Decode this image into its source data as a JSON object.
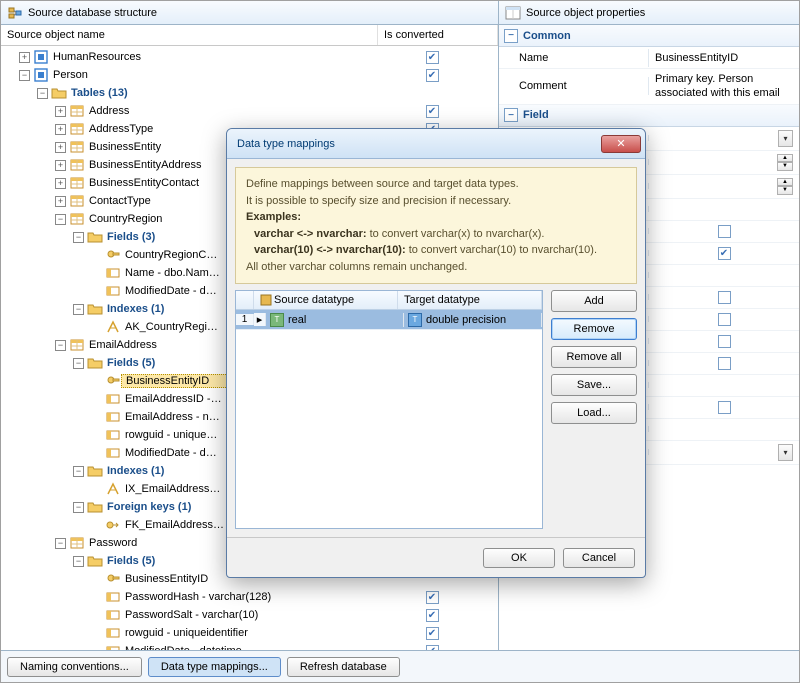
{
  "left_panel": {
    "title": "Source database structure",
    "cols": {
      "name": "Source object name",
      "conv": "Is converted"
    }
  },
  "right_panel": {
    "title": "Source object properties",
    "groups": {
      "common": "Common",
      "field": "Field"
    },
    "props": {
      "name_label": "Name",
      "name_value": "BusinessEntityID",
      "comment_label": "Comment",
      "comment_value": "Primary key. Person associated with this email"
    },
    "field_rows": [
      {
        "kind": "dropdown"
      },
      {
        "kind": "spin"
      },
      {
        "kind": "spin"
      },
      {
        "kind": "blank"
      },
      {
        "kind": "check",
        "checked": false
      },
      {
        "kind": "check",
        "checked": true
      },
      {
        "kind": "blank"
      },
      {
        "kind": "check",
        "checked": false
      },
      {
        "kind": "check",
        "checked": false
      },
      {
        "kind": "check",
        "checked": false
      },
      {
        "kind": "check",
        "checked": false
      },
      {
        "kind": "blank"
      },
      {
        "kind": "check",
        "checked": false
      },
      {
        "kind": "blank"
      },
      {
        "kind": "dropdown"
      }
    ]
  },
  "tree": [
    {
      "d": 1,
      "exp": "plus",
      "icon": "schema",
      "label": "HumanResources",
      "chk": true
    },
    {
      "d": 1,
      "exp": "minus",
      "icon": "schema",
      "label": "Person",
      "chk": true
    },
    {
      "d": 2,
      "exp": "minus",
      "icon": "folder",
      "label": "Tables (13)",
      "chk": null,
      "bold": true
    },
    {
      "d": 3,
      "exp": "plus",
      "icon": "table",
      "label": "Address",
      "chk": true
    },
    {
      "d": 3,
      "exp": "plus",
      "icon": "table",
      "label": "AddressType",
      "chk": true
    },
    {
      "d": 3,
      "exp": "plus",
      "icon": "table",
      "label": "BusinessEntity",
      "chk": true
    },
    {
      "d": 3,
      "exp": "plus",
      "icon": "table",
      "label": "BusinessEntityAddress",
      "chk": true
    },
    {
      "d": 3,
      "exp": "plus",
      "icon": "table",
      "label": "BusinessEntityContact",
      "chk": true
    },
    {
      "d": 3,
      "exp": "plus",
      "icon": "table",
      "label": "ContactType",
      "chk": true
    },
    {
      "d": 3,
      "exp": "minus",
      "icon": "table",
      "label": "CountryRegion",
      "chk": true
    },
    {
      "d": 4,
      "exp": "minus",
      "icon": "folder",
      "label": "Fields (3)",
      "chk": null,
      "bold": true
    },
    {
      "d": 5,
      "exp": "none",
      "icon": "key",
      "label": "CountryRegionC…",
      "chk": null
    },
    {
      "d": 5,
      "exp": "none",
      "icon": "field",
      "label": "Name - dbo.Nam…",
      "chk": null
    },
    {
      "d": 5,
      "exp": "none",
      "icon": "field",
      "label": "ModifiedDate - d…",
      "chk": null
    },
    {
      "d": 4,
      "exp": "minus",
      "icon": "folder",
      "label": "Indexes (1)",
      "chk": null,
      "bold": true
    },
    {
      "d": 5,
      "exp": "none",
      "icon": "index",
      "label": "AK_CountryRegi…",
      "chk": null
    },
    {
      "d": 3,
      "exp": "minus",
      "icon": "table",
      "label": "EmailAddress",
      "chk": true
    },
    {
      "d": 4,
      "exp": "minus",
      "icon": "folder",
      "label": "Fields (5)",
      "chk": null,
      "bold": true
    },
    {
      "d": 5,
      "exp": "none",
      "icon": "key",
      "label": "BusinessEntityID",
      "chk": null,
      "selected": true
    },
    {
      "d": 5,
      "exp": "none",
      "icon": "field",
      "label": "EmailAddressID -…",
      "chk": null
    },
    {
      "d": 5,
      "exp": "none",
      "icon": "field",
      "label": "EmailAddress - n…",
      "chk": null
    },
    {
      "d": 5,
      "exp": "none",
      "icon": "field",
      "label": "rowguid - unique…",
      "chk": null
    },
    {
      "d": 5,
      "exp": "none",
      "icon": "field",
      "label": "ModifiedDate - d…",
      "chk": null
    },
    {
      "d": 4,
      "exp": "minus",
      "icon": "folder",
      "label": "Indexes (1)",
      "chk": null,
      "bold": true
    },
    {
      "d": 5,
      "exp": "none",
      "icon": "index",
      "label": "IX_EmailAddress…",
      "chk": null
    },
    {
      "d": 4,
      "exp": "minus",
      "icon": "folder",
      "label": "Foreign keys (1)",
      "chk": null,
      "bold": true
    },
    {
      "d": 5,
      "exp": "none",
      "icon": "fk",
      "label": "FK_EmailAddress…",
      "chk": null
    },
    {
      "d": 3,
      "exp": "minus",
      "icon": "table",
      "label": "Password",
      "chk": true
    },
    {
      "d": 4,
      "exp": "minus",
      "icon": "folder",
      "label": "Fields (5)",
      "chk": null,
      "bold": true
    },
    {
      "d": 5,
      "exp": "none",
      "icon": "key",
      "label": "BusinessEntityID",
      "chk": null
    },
    {
      "d": 5,
      "exp": "none",
      "icon": "field",
      "label": "PasswordHash - varchar(128)",
      "chk": true
    },
    {
      "d": 5,
      "exp": "none",
      "icon": "field",
      "label": "PasswordSalt - varchar(10)",
      "chk": true
    },
    {
      "d": 5,
      "exp": "none",
      "icon": "field",
      "label": "rowguid - uniqueidentifier",
      "chk": true
    },
    {
      "d": 5,
      "exp": "none",
      "icon": "field",
      "label": "ModifiedDate - datetime",
      "chk": true
    }
  ],
  "buttons": {
    "naming": "Naming conventions...",
    "mappings": "Data type mappings...",
    "refresh": "Refresh database"
  },
  "dialog": {
    "title": "Data type mappings",
    "hint_l1": "Define mappings between source and target data types.",
    "hint_l2": "It is possible to specify size and precision if necessary.",
    "hint_l3": "Examples:",
    "hint_l4a": "varchar <-> nvarchar:",
    "hint_l4b": "to convert varchar(x) to nvarchar(x).",
    "hint_l5a": "varchar(10) <-> nvarchar(10):",
    "hint_l5b": "to convert varchar(10) to nvarchar(10).",
    "hint_l6": "All other varchar columns remain unchanged.",
    "grid": {
      "src_h": "Source datatype",
      "tgt_h": "Target datatype",
      "rows": [
        {
          "n": "1",
          "src": "real",
          "tgt": "double precision"
        }
      ]
    },
    "side": {
      "add": "Add",
      "remove": "Remove",
      "remove_all": "Remove all",
      "save": "Save...",
      "load": "Load..."
    },
    "ok": "OK",
    "cancel": "Cancel"
  }
}
